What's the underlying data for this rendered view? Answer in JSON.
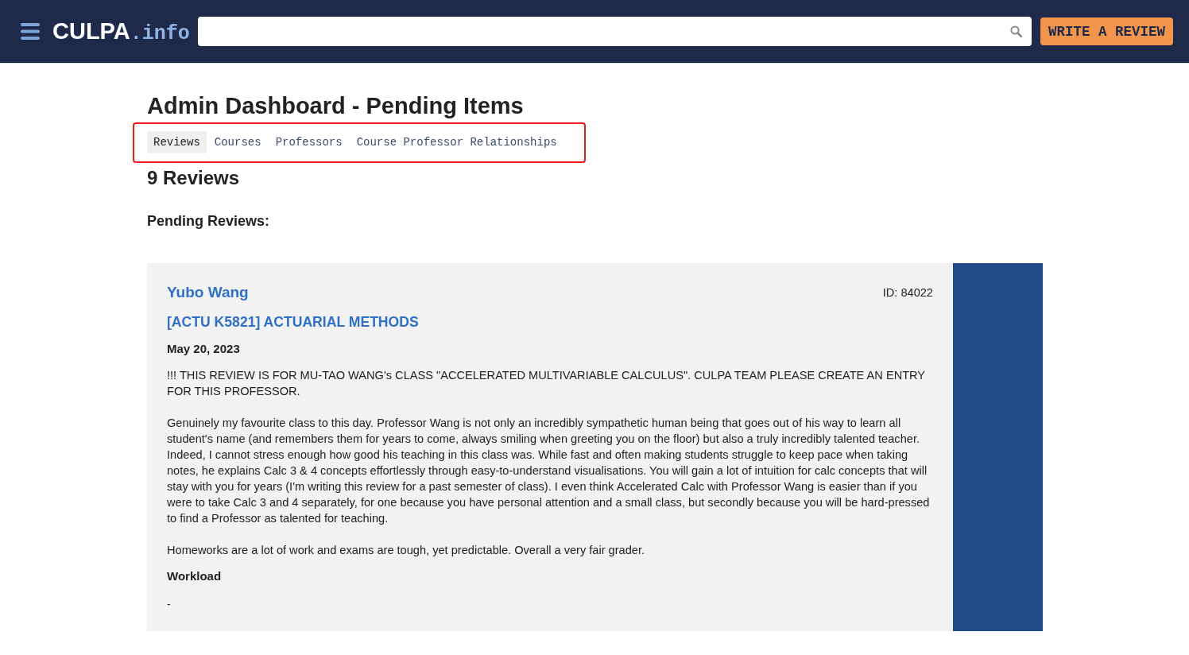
{
  "header": {
    "logo_main": "CULPA",
    "logo_suffix": ".info",
    "write_button": "WRITE A REVIEW"
  },
  "page": {
    "title": "Admin Dashboard - Pending Items",
    "tabs_highlighted": true,
    "tabs": [
      {
        "label": "Reviews",
        "selected": true
      },
      {
        "label": "Courses",
        "selected": false
      },
      {
        "label": "Professors",
        "selected": false
      },
      {
        "label": "Course Professor Relationships",
        "selected": false
      }
    ],
    "count_heading": "9 Reviews",
    "section_heading": "Pending Reviews:"
  },
  "reviews": [
    {
      "professor": "Yubo Wang",
      "id": "ID: 84022",
      "course": "[ACTU K5821] ACTUARIAL METHODS",
      "date": "May 20, 2023",
      "paragraphs": [
        "!!! THIS REVIEW IS FOR MU-TAO WANG's CLASS \"ACCELERATED MULTIVARIABLE CALCULUS\". CULPA TEAM PLEASE CREATE AN ENTRY FOR THIS PROFESSOR.",
        "Genuinely my favourite class to this day. Professor Wang is not only an incredibly sympathetic human being that goes out of his way to learn all student's name (and remembers them for years to come, always smiling when greeting you on the floor) but also a truly incredibly talented teacher. Indeed, I cannot stress enough how good his teaching in this class was. While fast and often making students struggle to keep pace when taking notes, he explains Calc 3 & 4 concepts effortlessly through easy-to-understand visualisations. You will gain a lot of intuition for calc concepts that will stay with you for years (I'm writing this review for a past semester of class). I even think Accelerated Calc with Professor Wang is easier than if you were to take Calc 3 and 4 separately, for one because you have personal attention and a small class, but secondly because you will be hard-pressed to find a Professor as talented for teaching.",
        "Homeworks are a lot of work and exams are tough, yet predictable. Overall a very fair grader."
      ],
      "workload_heading": "Workload",
      "workload": "-"
    }
  ]
}
